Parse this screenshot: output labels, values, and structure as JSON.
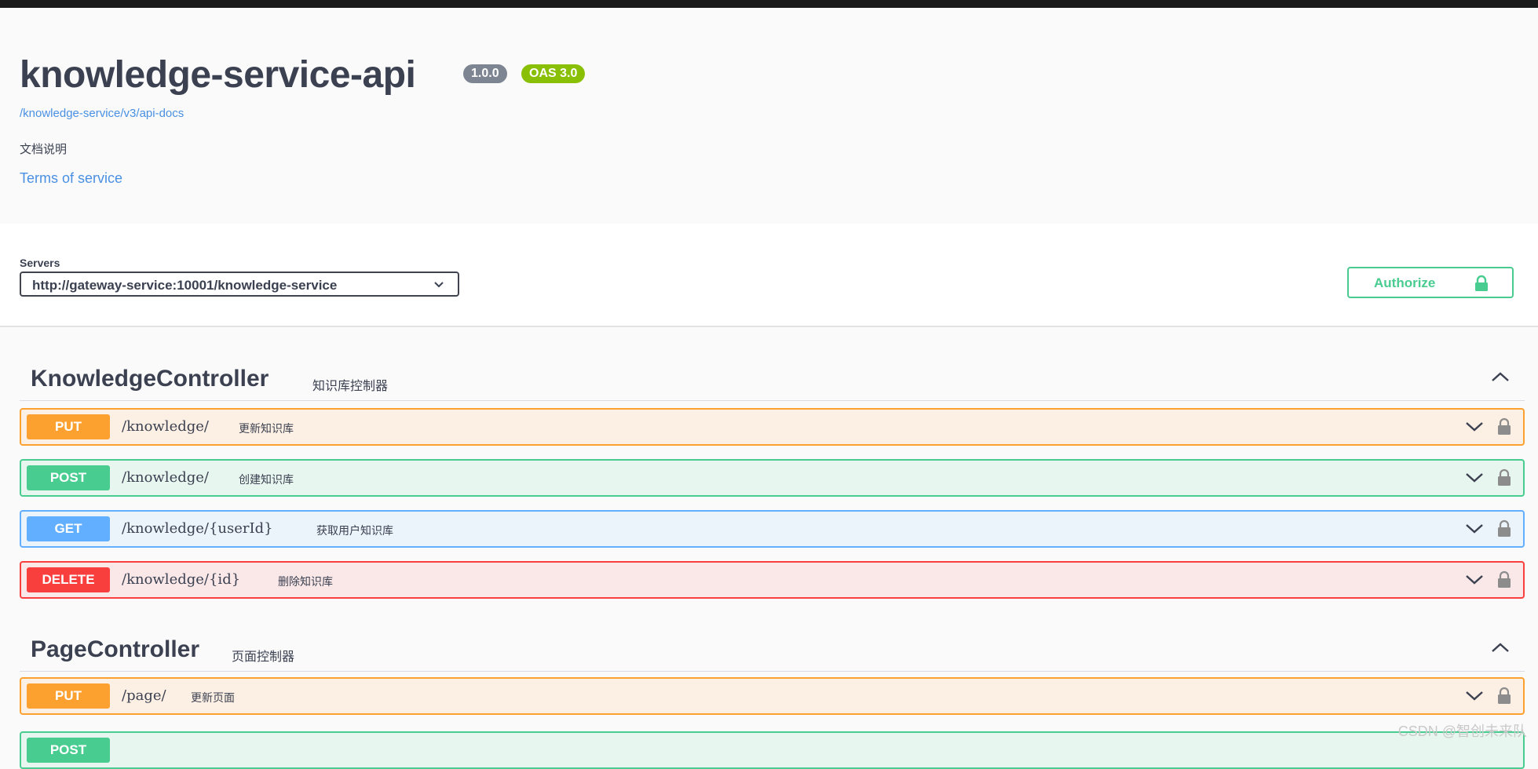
{
  "info": {
    "title": "knowledge-service-api",
    "version": "1.0.0",
    "oas": "OAS 3.0",
    "docs_url": "/knowledge-service/v3/api-docs",
    "description": "文档说明",
    "terms": "Terms of service"
  },
  "servers": {
    "label": "Servers",
    "selected": "http://gateway-service:10001/knowledge-service"
  },
  "authorize": {
    "label": "Authorize"
  },
  "colors": {
    "put": "#fca130",
    "post": "#49cc90",
    "get": "#61affe",
    "delete": "#f93e3e"
  },
  "tags": [
    {
      "name": "KnowledgeController",
      "description": "知识库控制器",
      "operations": [
        {
          "method": "PUT",
          "path": "/knowledge/",
          "summary": "更新知识库"
        },
        {
          "method": "POST",
          "path": "/knowledge/",
          "summary": "创建知识库"
        },
        {
          "method": "GET",
          "path": "/knowledge/{userId}",
          "summary": "获取用户知识库"
        },
        {
          "method": "DELETE",
          "path": "/knowledge/{id}",
          "summary": "删除知识库"
        }
      ]
    },
    {
      "name": "PageController",
      "description": "页面控制器",
      "operations": [
        {
          "method": "PUT",
          "path": "/page/",
          "summary": "更新页面"
        },
        {
          "method": "POST",
          "path": "",
          "summary": ""
        }
      ]
    }
  ],
  "watermark": "CSDN @智创未来队"
}
